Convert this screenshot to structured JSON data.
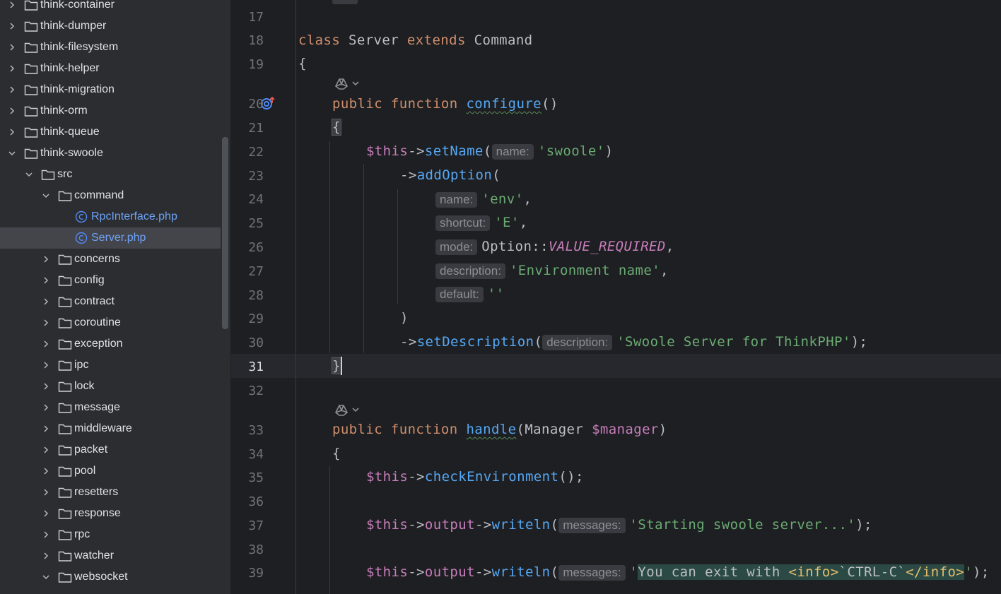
{
  "project_tree": {
    "items": [
      {
        "label": "think-container",
        "depth": 0,
        "expanded": false,
        "type": "folder"
      },
      {
        "label": "think-dumper",
        "depth": 0,
        "expanded": false,
        "type": "folder"
      },
      {
        "label": "think-filesystem",
        "depth": 0,
        "expanded": false,
        "type": "folder"
      },
      {
        "label": "think-helper",
        "depth": 0,
        "expanded": false,
        "type": "folder"
      },
      {
        "label": "think-migration",
        "depth": 0,
        "expanded": false,
        "type": "folder"
      },
      {
        "label": "think-orm",
        "depth": 0,
        "expanded": false,
        "type": "folder"
      },
      {
        "label": "think-queue",
        "depth": 0,
        "expanded": false,
        "type": "folder"
      },
      {
        "label": "think-swoole",
        "depth": 0,
        "expanded": true,
        "type": "folder"
      },
      {
        "label": "src",
        "depth": 1,
        "expanded": true,
        "type": "folder"
      },
      {
        "label": "command",
        "depth": 2,
        "expanded": true,
        "type": "folder"
      },
      {
        "label": "RpcInterface.php",
        "depth": 3,
        "type": "class"
      },
      {
        "label": "Server.php",
        "depth": 3,
        "type": "class",
        "selected": true
      },
      {
        "label": "concerns",
        "depth": 2,
        "expanded": false,
        "type": "folder"
      },
      {
        "label": "config",
        "depth": 2,
        "expanded": false,
        "type": "folder"
      },
      {
        "label": "contract",
        "depth": 2,
        "expanded": false,
        "type": "folder"
      },
      {
        "label": "coroutine",
        "depth": 2,
        "expanded": false,
        "type": "folder"
      },
      {
        "label": "exception",
        "depth": 2,
        "expanded": false,
        "type": "folder"
      },
      {
        "label": "ipc",
        "depth": 2,
        "expanded": false,
        "type": "folder"
      },
      {
        "label": "lock",
        "depth": 2,
        "expanded": false,
        "type": "folder"
      },
      {
        "label": "message",
        "depth": 2,
        "expanded": false,
        "type": "folder"
      },
      {
        "label": "middleware",
        "depth": 2,
        "expanded": false,
        "type": "folder"
      },
      {
        "label": "packet",
        "depth": 2,
        "expanded": false,
        "type": "folder"
      },
      {
        "label": "pool",
        "depth": 2,
        "expanded": false,
        "type": "folder"
      },
      {
        "label": "resetters",
        "depth": 2,
        "expanded": false,
        "type": "folder"
      },
      {
        "label": "response",
        "depth": 2,
        "expanded": false,
        "type": "folder"
      },
      {
        "label": "rpc",
        "depth": 2,
        "expanded": false,
        "type": "folder"
      },
      {
        "label": "watcher",
        "depth": 2,
        "expanded": false,
        "type": "folder"
      },
      {
        "label": "websocket",
        "depth": 2,
        "expanded": true,
        "type": "folder"
      }
    ]
  },
  "editor": {
    "current_line": "31",
    "line_numbers": [
      "17",
      "18",
      "19",
      "20",
      "21",
      "22",
      "23",
      "24",
      "25",
      "26",
      "27",
      "28",
      "29",
      "30",
      "31",
      "32",
      "33",
      "34",
      "35",
      "36",
      "37",
      "38",
      "39"
    ],
    "code": {
      "l18": {
        "kw1": "class",
        "name1": " Server ",
        "kw2": "extends",
        "name2": " Command"
      },
      "l19": "{",
      "l20": {
        "kw1": "public",
        "kw2": "function",
        "fn": "configure",
        "rest": "()"
      },
      "l21": "{",
      "l22": {
        "var": "$this",
        "arrow": "->",
        "fn": "setName",
        "open": "(",
        "hint": "name:",
        "str": "'swoole'",
        "close": ")"
      },
      "l23": {
        "arrow": "->",
        "fn": "addOption",
        "open": "("
      },
      "l24": {
        "hint": "name:",
        "str": "'env'",
        "punct": ","
      },
      "l25": {
        "hint": "shortcut:",
        "str": "'E'",
        "punct": ","
      },
      "l26": {
        "hint": "mode:",
        "cls": "Option::",
        "const": "VALUE_REQUIRED",
        "punct": ","
      },
      "l27": {
        "hint": "description:",
        "str": "'Environment name'",
        "punct": ","
      },
      "l28": {
        "hint": "default:",
        "str": "''"
      },
      "l29": ")",
      "l30": {
        "arrow": "->",
        "fn": "setDescription",
        "open": "(",
        "hint": "description:",
        "str": "'Swoole Server for ThinkPHP'",
        "close": ");"
      },
      "l31": "}",
      "l33": {
        "kw1": "public",
        "kw2": "function",
        "fn": "handle",
        "open": "(",
        "type": "Manager ",
        "var": "$manager",
        "close": ")"
      },
      "l34": "{",
      "l35": {
        "var": "$this",
        "arrow": "->",
        "fn": "checkEnvironment",
        "close": "();"
      },
      "l37": {
        "var": "$this",
        "arrow": "->",
        "prop": "output",
        "arrow2": "->",
        "fn": "writeln",
        "open": "(",
        "hint": "messages:",
        "str": "'Starting swoole server...'",
        "close": ");"
      },
      "l39": {
        "var": "$this",
        "arrow": "->",
        "prop": "output",
        "arrow2": "->",
        "fn": "writeln",
        "open": "(",
        "hint": "messages:",
        "q1": "'",
        "s1": "You can exit with ",
        "t1": "<info>",
        "s2": "`CTRL-C`",
        "t2": "</info>",
        "q2": "'",
        "close": ");"
      }
    }
  },
  "icons": {
    "folder": "folder-icon",
    "class_file": "php-class-icon",
    "chevron_right": "chevron-right-icon",
    "chevron_down": "chevron-down-icon",
    "ai_hint": "ai-assistant-icon",
    "override": "overrides-method-icon"
  },
  "colors": {
    "keyword": "#cf8e6d",
    "function": "#56a8f5",
    "string": "#6aab73",
    "variable": "#c77dbb",
    "sidebar_bg": "#2b2d30",
    "editor_bg": "#1e1f22"
  }
}
